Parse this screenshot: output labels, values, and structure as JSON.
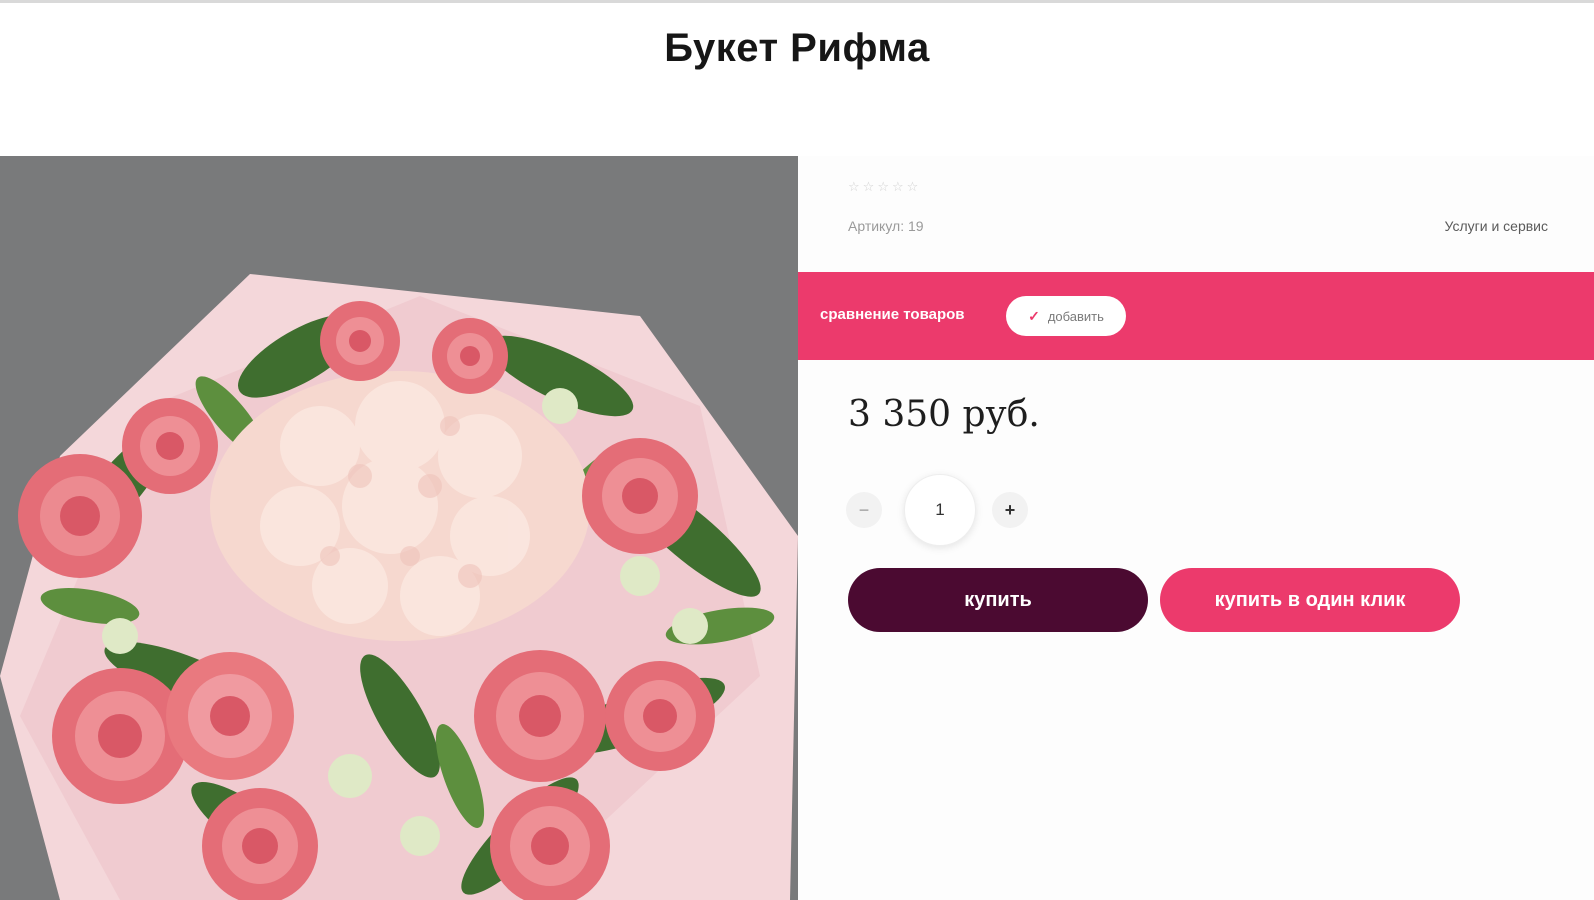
{
  "page": {
    "title": "Букет Рифма"
  },
  "product_image": {
    "alt": "Букет Рифма"
  },
  "product": {
    "rating": {
      "value": 0,
      "max": 5,
      "star_glyph": "☆"
    },
    "sku_text": "Артикул: 19",
    "services_link": "Услуги и сервис",
    "compare": {
      "label": "сравнение товаров",
      "add_label": "добавить",
      "check_icon": "✓"
    },
    "price": "3 350 руб.",
    "quantity": {
      "minus": "−",
      "value": "1",
      "plus": "+"
    },
    "buy_label": "купить",
    "one_click_label": "купить в один клик"
  },
  "colors": {
    "accent": "#ec3a6c",
    "buy_button": "#4b0a31",
    "photo_background": "#737576"
  }
}
